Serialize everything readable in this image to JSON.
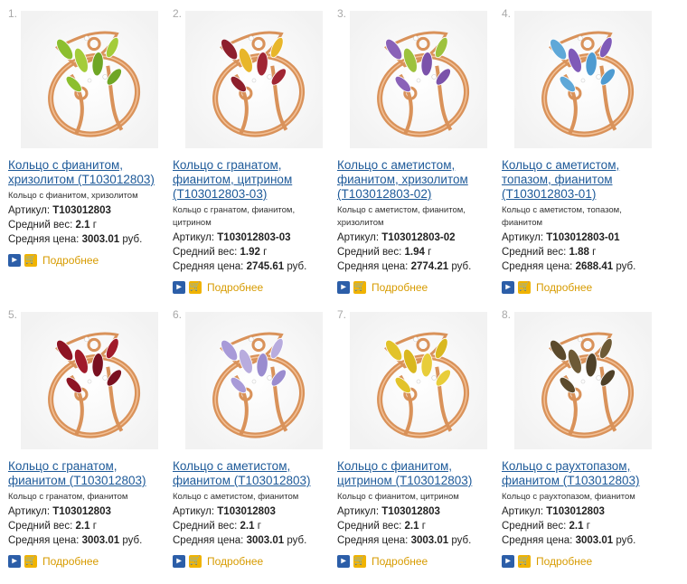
{
  "products": [
    {
      "index": "1.",
      "title": "Кольцо с фианитом, хризолитом (Т103012803)",
      "description": "Кольцо с фианитом, хризолитом",
      "article_label": "Артикул:",
      "article": "Т103012803",
      "weight_label": "Средний вес:",
      "weight": "2.1",
      "weight_unit": "г",
      "price_label": "Средняя цена:",
      "price": "3003.01",
      "price_unit": "руб.",
      "more_label": "Подробнее",
      "stone_colors": [
        "#8cbf2f",
        "#a4cc3a",
        "#6fa625"
      ]
    },
    {
      "index": "2.",
      "title": "Кольцо с гранатом, фианитом, цитрином (Т103012803-03)",
      "description": "Кольцо с гранатом, фианитом, цитрином",
      "article_label": "Артикул:",
      "article": "Т103012803-03",
      "weight_label": "Средний вес:",
      "weight": "1.92",
      "weight_unit": "г",
      "price_label": "Средняя цена:",
      "price": "2745.61",
      "price_unit": "руб.",
      "more_label": "Подробнее",
      "stone_colors": [
        "#8e1f2c",
        "#e8b62a",
        "#a02634"
      ]
    },
    {
      "index": "3.",
      "title": "Кольцо с аметистом, фианитом, хризолитом (Т103012803-02)",
      "description": "Кольцо с аметистом, фианитом, хризолитом",
      "article_label": "Артикул:",
      "article": "Т103012803-02",
      "weight_label": "Средний вес:",
      "weight": "1.94",
      "weight_unit": "г",
      "price_label": "Средняя цена:",
      "price": "2774.21",
      "price_unit": "руб.",
      "more_label": "Подробнее",
      "stone_colors": [
        "#8a62b8",
        "#9dc23e",
        "#7b52aa"
      ]
    },
    {
      "index": "4.",
      "title": "Кольцо с аметистом, топазом, фианитом (Т103012803-01)",
      "description": "Кольцо с аметистом, топазом, фианитом",
      "article_label": "Артикул:",
      "article": "Т103012803-01",
      "weight_label": "Средний вес:",
      "weight": "1.88",
      "weight_unit": "г",
      "price_label": "Средняя цена:",
      "price": "2688.41",
      "price_unit": "руб.",
      "more_label": "Подробнее",
      "stone_colors": [
        "#5fa8d8",
        "#7f5ab8",
        "#4e9bd1"
      ]
    },
    {
      "index": "5.",
      "title": "Кольцо с гранатом, фианитом (Т103012803)",
      "description": "Кольцо с гранатом, фианитом",
      "article_label": "Артикул:",
      "article": "Т103012803",
      "weight_label": "Средний вес:",
      "weight": "2.1",
      "weight_unit": "г",
      "price_label": "Средняя цена:",
      "price": "3003.01",
      "price_unit": "руб.",
      "more_label": "Подробнее",
      "stone_colors": [
        "#8e1424",
        "#a01a2a",
        "#7a1020"
      ]
    },
    {
      "index": "6.",
      "title": "Кольцо с аметистом, фианитом (Т103012803)",
      "description": "Кольцо с аметистом, фианитом",
      "article_label": "Артикул:",
      "article": "Т103012803",
      "weight_label": "Средний вес:",
      "weight": "2.1",
      "weight_unit": "г",
      "price_label": "Средняя цена:",
      "price": "3003.01",
      "price_unit": "руб.",
      "more_label": "Подробнее",
      "stone_colors": [
        "#a89ad8",
        "#b8acde",
        "#9a8ccf"
      ]
    },
    {
      "index": "7.",
      "title": "Кольцо с фианитом, цитрином (Т103012803)",
      "description": "Кольцо с фианитом, цитрином",
      "article_label": "Артикул:",
      "article": "Т103012803",
      "weight_label": "Средний вес:",
      "weight": "2.1",
      "weight_unit": "г",
      "price_label": "Средняя цена:",
      "price": "3003.01",
      "price_unit": "руб.",
      "more_label": "Подробнее",
      "stone_colors": [
        "#e2c32a",
        "#d9b820",
        "#e8cd3a"
      ]
    },
    {
      "index": "8.",
      "title": "Кольцо с раухтопазом, фианитом (Т103012803)",
      "description": "Кольцо с раухтопазом, фианитом",
      "article_label": "Артикул:",
      "article": "Т103012803",
      "weight_label": "Средний вес:",
      "weight": "2.1",
      "weight_unit": "г",
      "price_label": "Средняя цена:",
      "price": "3003.01",
      "price_unit": "руб.",
      "more_label": "Подробнее",
      "stone_colors": [
        "#5b4a2c",
        "#6d5a36",
        "#4f4128"
      ]
    }
  ],
  "colors": {
    "link": "#1e5a99",
    "more": "#d79b00",
    "gold": "#d9925a",
    "arrow_icon_bg": "#2c5ea8",
    "cart_icon_bg": "#f0b300"
  },
  "icons": {
    "arrow": "arrow-right-icon",
    "cart": "cart-icon"
  }
}
